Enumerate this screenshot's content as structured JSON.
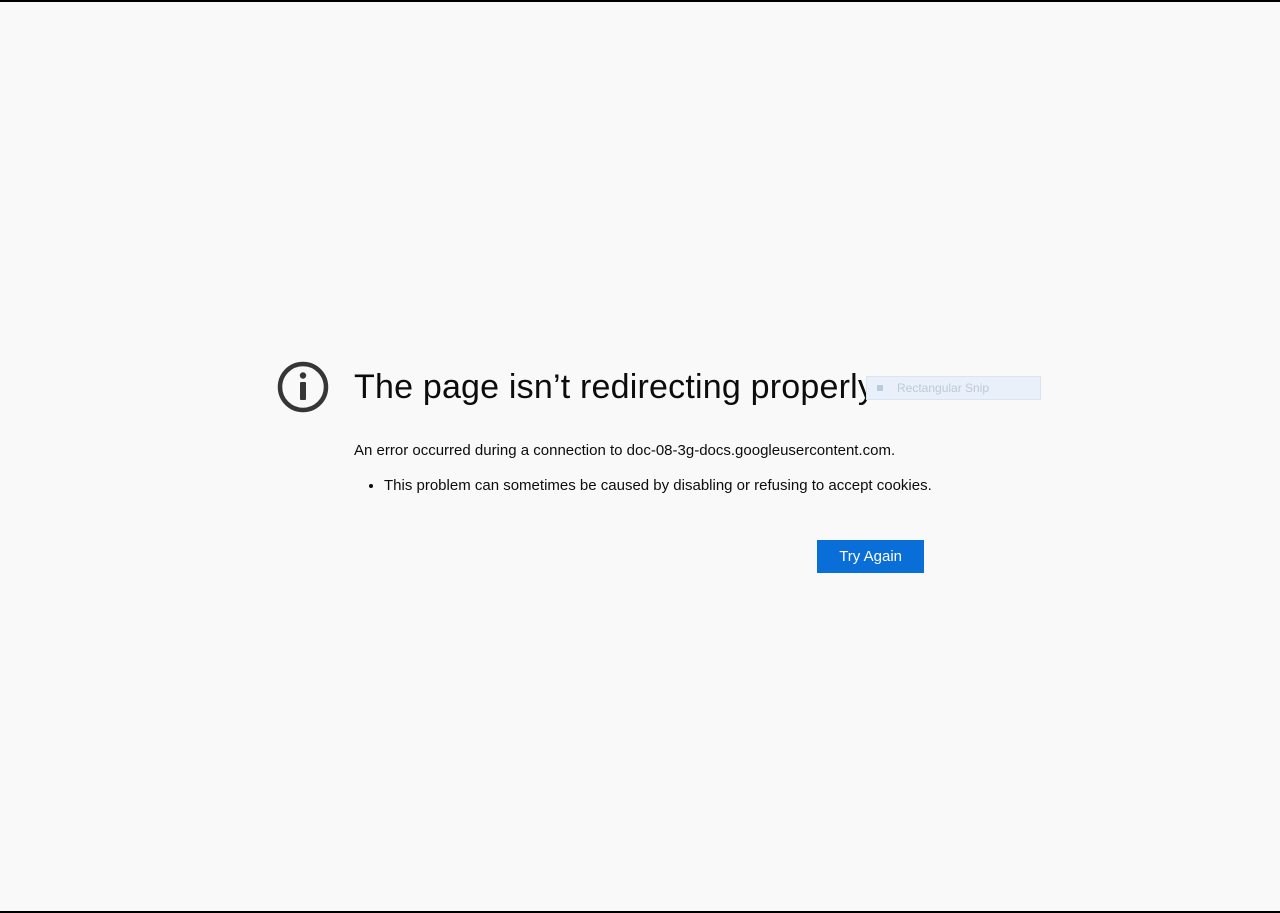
{
  "error": {
    "title": "The page isn’t redirecting properly",
    "subtext": "An error occurred during a connection to doc-08-3g-docs.googleusercontent.com.",
    "cause": "This problem can sometimes be caused by disabling or refusing to accept cookies.",
    "retry_label": "Try Again"
  },
  "snip": {
    "label": "Rectangular Snip"
  }
}
